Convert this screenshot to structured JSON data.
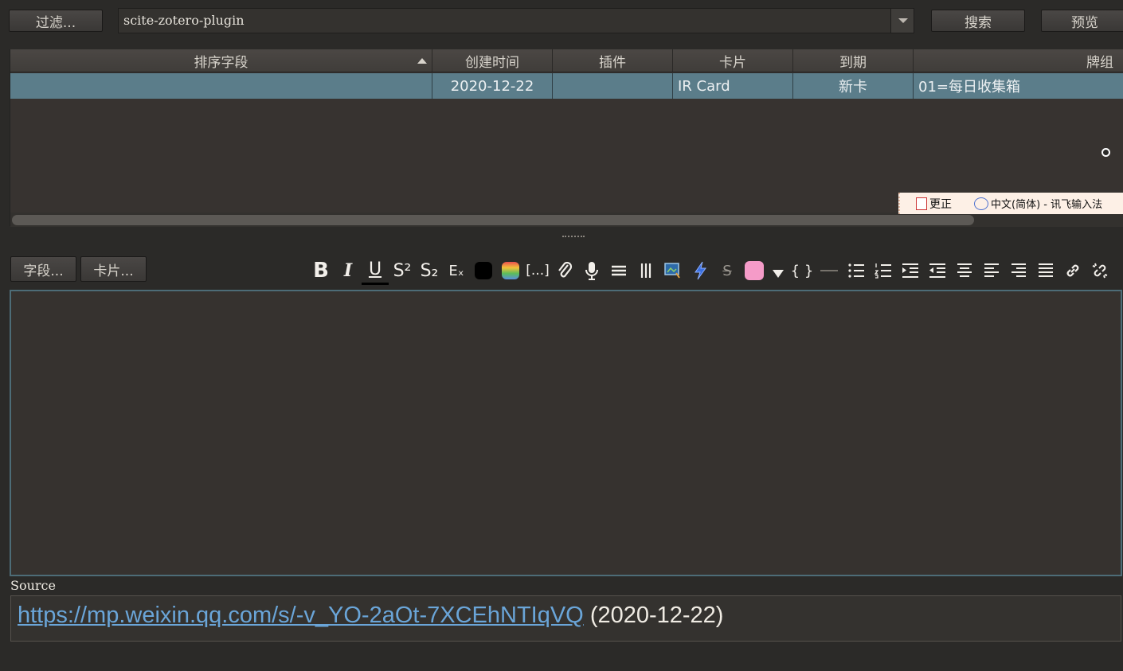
{
  "top_bar": {
    "filter_label": "过滤...",
    "search_value": "scite-zotero-plugin",
    "search_button": "搜索",
    "preview_button": "预览"
  },
  "table": {
    "columns": [
      "排序字段",
      "创建时间",
      "插件",
      "卡片",
      "到期",
      "牌组"
    ],
    "sort_indicator": "ascending",
    "rows": [
      {
        "sort_field": "",
        "created": "2020-12-22",
        "plugin": "",
        "card": "IR Card",
        "due": "新卡",
        "deck": "01=每日收集箱"
      }
    ]
  },
  "ime_bar": {
    "correct_label": "更正",
    "mode_label": "中文(简体) - 讯飞输入法"
  },
  "editor_bar": {
    "fields_button": "字段...",
    "cards_button": "卡片..."
  },
  "toolbar": {
    "bold": "B",
    "italic": "I",
    "underline": "U",
    "superscript": "S²",
    "subscript": "S₂",
    "clear_format": "Eₓ",
    "cloze": "[...]",
    "braces": "{ }",
    "icons": [
      "bold-icon",
      "italic-icon",
      "underline-icon",
      "superscript-icon",
      "subscript-icon",
      "clear-format-icon",
      "text-color-icon",
      "highlight-color-icon",
      "cloze-icon",
      "attach-icon",
      "record-audio-icon",
      "hr-lines-icon",
      "columns-icon",
      "image-icon",
      "lightning-icon",
      "strikethrough-icon",
      "pink-color-icon",
      "dropdown-arrow-icon",
      "code-braces-icon",
      "horizontal-rule-icon",
      "bullet-list-icon",
      "numbered-list-icon",
      "indent-icon",
      "outdent-icon",
      "align-center-icon",
      "align-left-icon",
      "align-right-icon",
      "justify-icon",
      "link-icon",
      "unlink-icon"
    ]
  },
  "source": {
    "label": "Source",
    "url": "https://mp.weixin.qq.com/s/-v_YO-2aOt-7XCEhNTIqVQ",
    "date": "(2020-12-22)"
  },
  "colors": {
    "background": "#2b2a28",
    "selected_row": "#5b7d8a",
    "link": "#6aa5d8",
    "editor_border": "#4d6c77",
    "pink_swatch": "#f59bc8"
  }
}
